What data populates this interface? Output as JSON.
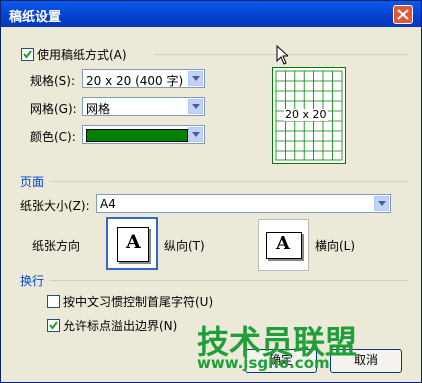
{
  "window": {
    "title": "稿纸设置"
  },
  "manuscript": {
    "use_checkbox_label": "使用稿纸方式(A)",
    "use_checked": true,
    "spec_label": "规格(S):",
    "spec_value": "20 x 20 (400 字)",
    "grid_label": "网格(G):",
    "grid_value": "网格",
    "color_label": "颜色(C):",
    "color_value": "#008000",
    "preview_text": "20 x 20"
  },
  "page": {
    "section_label": "页面",
    "paper_size_label": "纸张大小(Z):",
    "paper_size_value": "A4",
    "orientation_label": "纸张方向",
    "portrait_label": "纵向(T)",
    "landscape_label": "横向(L)",
    "orientation_glyph": "A"
  },
  "linebreak": {
    "section_label": "换行",
    "option1_label": "按中文习惯控制首尾字符(U)",
    "option1_checked": false,
    "option2_label": "允许标点溢出边界(N)",
    "option2_checked": true
  },
  "buttons": {
    "ok": "确定",
    "cancel": "取消"
  },
  "watermark": {
    "text": "技术员联盟",
    "url": "www.jsgho.com"
  }
}
